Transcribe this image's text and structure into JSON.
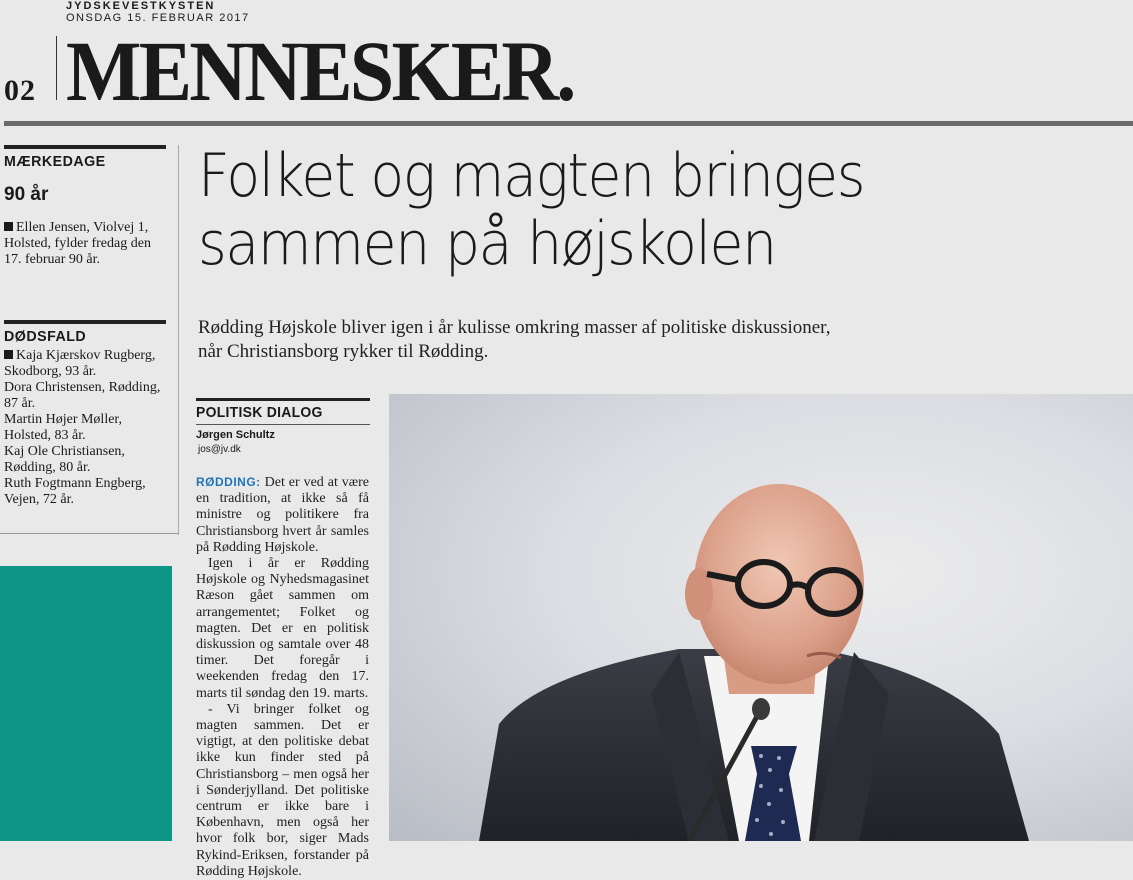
{
  "masthead": {
    "paper_name": "JYDSKEVESTKYSTEN",
    "date": "ONSDAG 15. FEBRUAR 2017",
    "page_number": "02",
    "section": "MENNESKER."
  },
  "sidebar": {
    "milestones": {
      "heading": "MÆRKEDAGE",
      "subheading": "90 år",
      "entry": "Ellen Jensen, Violvej 1, Holsted, fylder fredag den 17. februar 90 år."
    },
    "deaths": {
      "heading": "DØDSFALD",
      "entries": [
        "Kaja Kjærskov Rugberg, Skodborg, 93 år.",
        "Dora Christensen, Rødding, 87 år.",
        "Martin Højer Møller, Holsted, 83 år.",
        "Kaj Ole Christiansen, Rødding, 80 år.",
        "Ruth Fogtmann Engberg, Vejen, 72 år."
      ]
    }
  },
  "article": {
    "headline_line1": "Folket og magten bringes",
    "headline_line2": "sammen på højskolen",
    "deck": "Rødding Højskole bliver igen i år kulisse omkring masser af politiske diskussioner, når Christiansborg rykker til Rødding.",
    "column_label": "POLITISK DIALOG",
    "byline": "Jørgen Schultz",
    "email": "jos@jv.dk",
    "kicker": "RØDDING:",
    "paragraph1": "Det er ved at være en tradition, at ikke så få ministre og politikere fra Christiansborg hvert år samles på Rødding Højskole.",
    "paragraph2": "Igen i år er Rødding Højskole og Nyhedsmagasinet Ræson gået sammen om arrangementet; Folket og magten. Det er en politisk diskussion og samtale over 48 timer. Det foregår i weekenden fredag den 17. marts til søndag den 19. marts.",
    "paragraph3": "- Vi bringer folket og magten sammen. Det er vigtigt, at den politiske debat ikke kun finder sted på Christiansborg – men også her i Sønderjylland. Det politiske centrum er ikke bare i København, men også her hvor folk bor, siger Mads Rykind-Eriksen, forstander på Rødding Højskole."
  }
}
